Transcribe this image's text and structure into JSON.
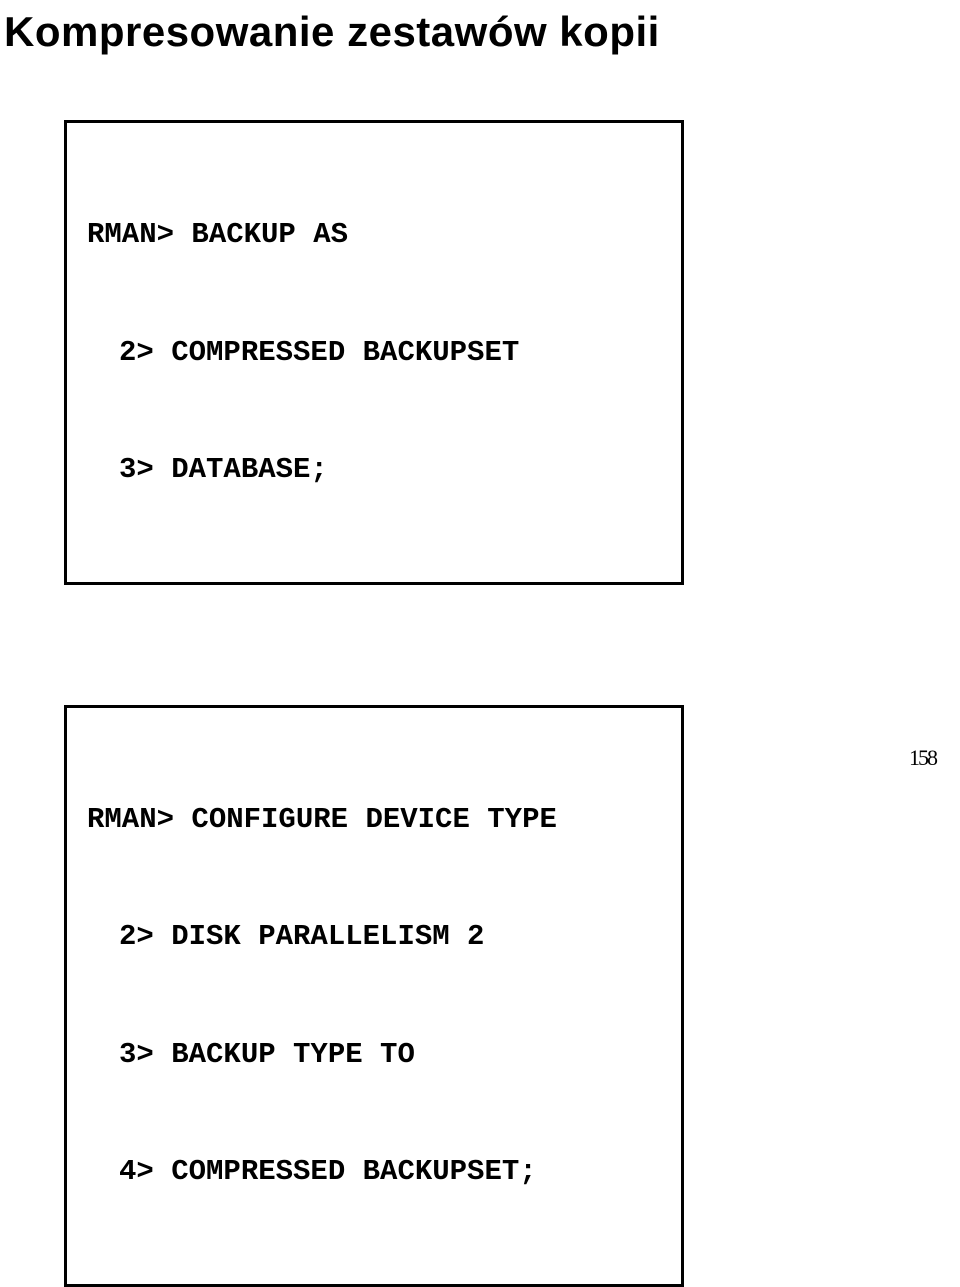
{
  "title": "Kompresowanie zestawów kopii",
  "box1": {
    "l1": "RMAN> BACKUP AS",
    "l2": "2> COMPRESSED BACKUPSET",
    "l3": "3> DATABASE;"
  },
  "box2": {
    "l1": "RMAN> CONFIGURE DEVICE TYPE",
    "l2": "2> DISK PARALLELISM 2",
    "l3": "3> BACKUP TYPE TO",
    "l4": "4> COMPRESSED BACKUPSET;"
  },
  "page_number": "158"
}
